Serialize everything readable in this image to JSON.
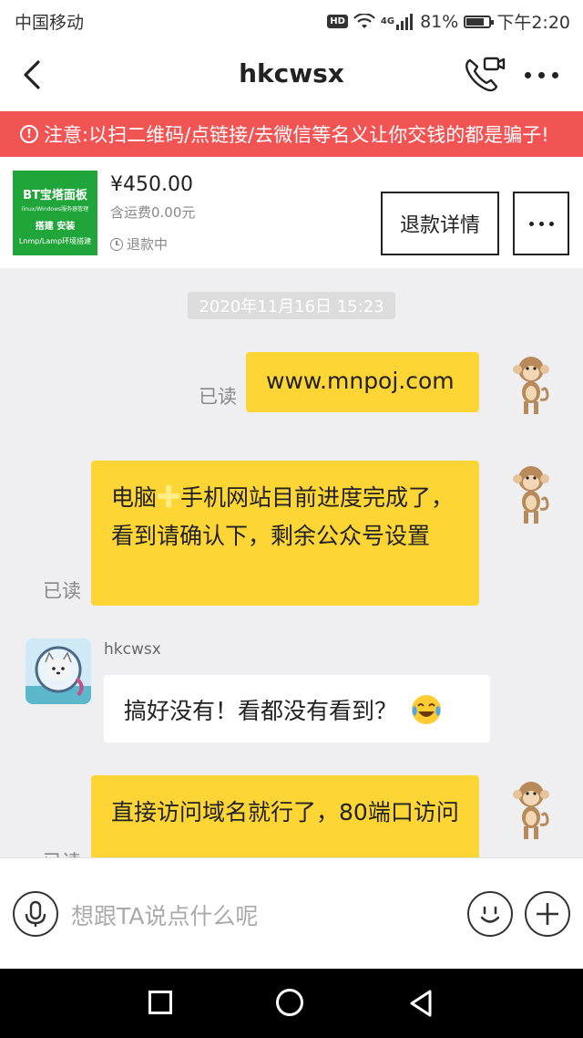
{
  "status_bar": {
    "carrier": "中国移动",
    "hd": "HD",
    "network": "4G",
    "battery": "81%",
    "battery_level": 0.81,
    "time": "下午2:20"
  },
  "nav": {
    "title": "hkcwsx"
  },
  "warning": {
    "icon": "!",
    "text": "注意:以扫二维码/点链接/去微信等名义让你交钱的都是骗子!"
  },
  "product": {
    "thumb_title": "BT宝塔面板",
    "thumb_subtitle": "linux/Windows服务器管理",
    "thumb_line2": "搭建 安装",
    "thumb_line3": "Lnmp/Lamp环境搭建",
    "price": "¥450.00",
    "shipping": "含运费0.00元",
    "status": "退款中",
    "refund_button": "退款详情"
  },
  "chat": {
    "timestamp": "2020年11月16日 15:23",
    "messages": [
      {
        "side": "right",
        "text": "www.mnpoj.com",
        "read": "已读"
      },
      {
        "side": "right",
        "text_a": "电脑",
        "text_b": "手机网站目前进度完成了，看到请确认下，剩余公众号设置",
        "read": "已读"
      },
      {
        "side": "left",
        "sender": "hkcwsx",
        "text": "搞好没有！看都没有看到？"
      },
      {
        "side": "right",
        "text": "直接访问域名就行了，80端口访问",
        "read": "已读"
      }
    ]
  },
  "input": {
    "placeholder": "想跟TA说点什么呢"
  }
}
